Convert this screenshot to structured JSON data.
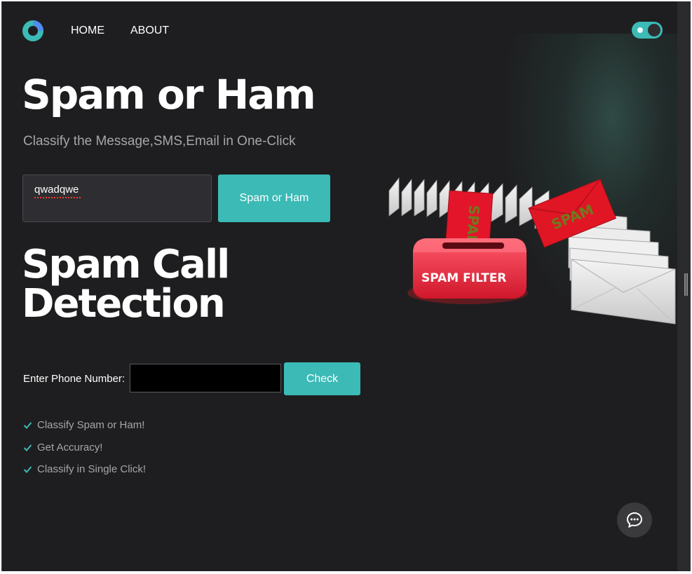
{
  "nav": {
    "home": "HOME",
    "about": "ABOUT"
  },
  "hero": {
    "title": "Spam or Ham",
    "subtitle": "Classify the Message,SMS,Email in One-Click",
    "message_value": "qwadqwe",
    "classify_button": "Spam or Ham"
  },
  "call": {
    "title_line1": "Spam Call",
    "title_line2": "Detection",
    "phone_label": "Enter Phone Number:",
    "phone_value": "",
    "check_button": "Check"
  },
  "features": [
    "Classify Spam or Ham!",
    "Get Accuracy!",
    "Classify in Single Click!"
  ],
  "illustration": {
    "box_label": "SPAM FILTER",
    "envelope_label_1": "SPAM",
    "envelope_label_2": "SPAM"
  },
  "theme": {
    "accent": "#3bbab6",
    "background": "#1e1e20",
    "toggle_on": true
  },
  "icons": {
    "logo": "brand-logo-icon",
    "check": "check-icon",
    "chat": "chat-bubble-icon"
  }
}
